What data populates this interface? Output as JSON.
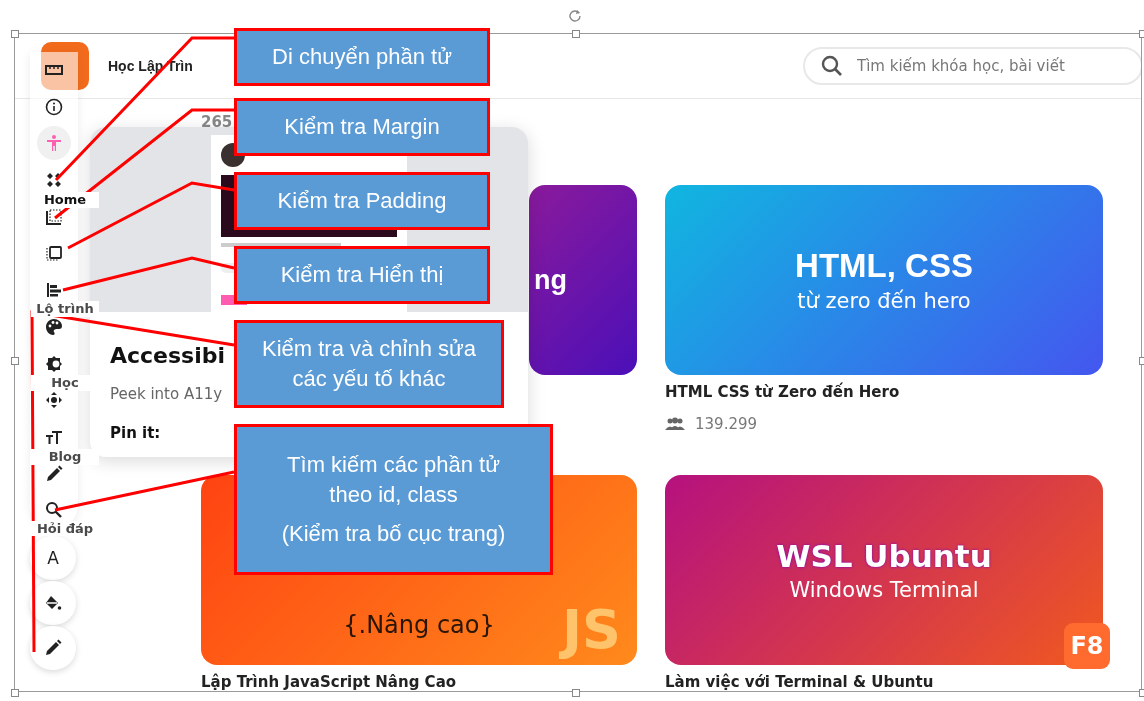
{
  "header": {
    "title": "Học Lập Trìn",
    "search": {
      "placeholder": "Tìm kiếm khóa học, bài viết"
    }
  },
  "sidebar": {
    "items": [
      {
        "label": "Home",
        "selected": true
      },
      {
        "label": "Lộ trình",
        "selected": false
      },
      {
        "label": "Học",
        "selected": false
      },
      {
        "label": "Blog",
        "selected": false
      },
      {
        "label": "Hỏi đáp",
        "selected": false
      }
    ]
  },
  "section_count": "265",
  "courses": [
    {
      "heading": "ng"
    },
    {
      "heading": "HTML, CSS",
      "subheading": "từ zero đến hero",
      "title": "HTML CSS từ Zero đến Hero",
      "students": "139.299"
    },
    {
      "subheading": "{.Nâng cao}",
      "mark": "JS",
      "title": "Lập Trình JavaScript Nâng Cao"
    },
    {
      "heading": "WSL Ubuntu",
      "subheading": "Windows Terminal",
      "badge": "F8",
      "title": "Làm việc với Terminal & Ubuntu"
    }
  ],
  "popup": {
    "title": "Accessibi",
    "description": "Peek into A11y",
    "pin_label": "Pin it:"
  },
  "toolbar": {
    "tools": [
      {
        "kind": "ruler",
        "selected": false
      },
      {
        "kind": "info",
        "selected": false
      },
      {
        "kind": "person",
        "selected": true
      },
      {
        "kind": "diamonds",
        "selected": false
      },
      {
        "kind": "margin",
        "selected": false
      },
      {
        "kind": "padding",
        "selected": false
      },
      {
        "kind": "align",
        "selected": false
      },
      {
        "kind": "palette",
        "selected": false
      },
      {
        "kind": "gear",
        "selected": false
      },
      {
        "kind": "move",
        "selected": false
      },
      {
        "kind": "textsize",
        "selected": false
      },
      {
        "kind": "pencil",
        "selected": false
      },
      {
        "kind": "search",
        "selected": false
      }
    ],
    "round_tools": [
      {
        "kind": "glyph",
        "glyph": "A"
      },
      {
        "kind": "bucket"
      },
      {
        "kind": "pencil"
      }
    ]
  },
  "callouts": [
    {
      "lines": [
        "Di chuyển phần tử"
      ]
    },
    {
      "lines": [
        "Kiểm tra Margin"
      ]
    },
    {
      "lines": [
        "Kiểm tra Padding"
      ]
    },
    {
      "lines": [
        "Kiểm tra Hiển thị"
      ]
    },
    {
      "lines": [
        "Kiểm tra và chỉnh sửa các yếu tố khác"
      ]
    },
    {
      "lines": [
        "Tìm kiếm các phần tử theo id, class",
        "(Kiểm tra bố cục trang)"
      ]
    }
  ]
}
